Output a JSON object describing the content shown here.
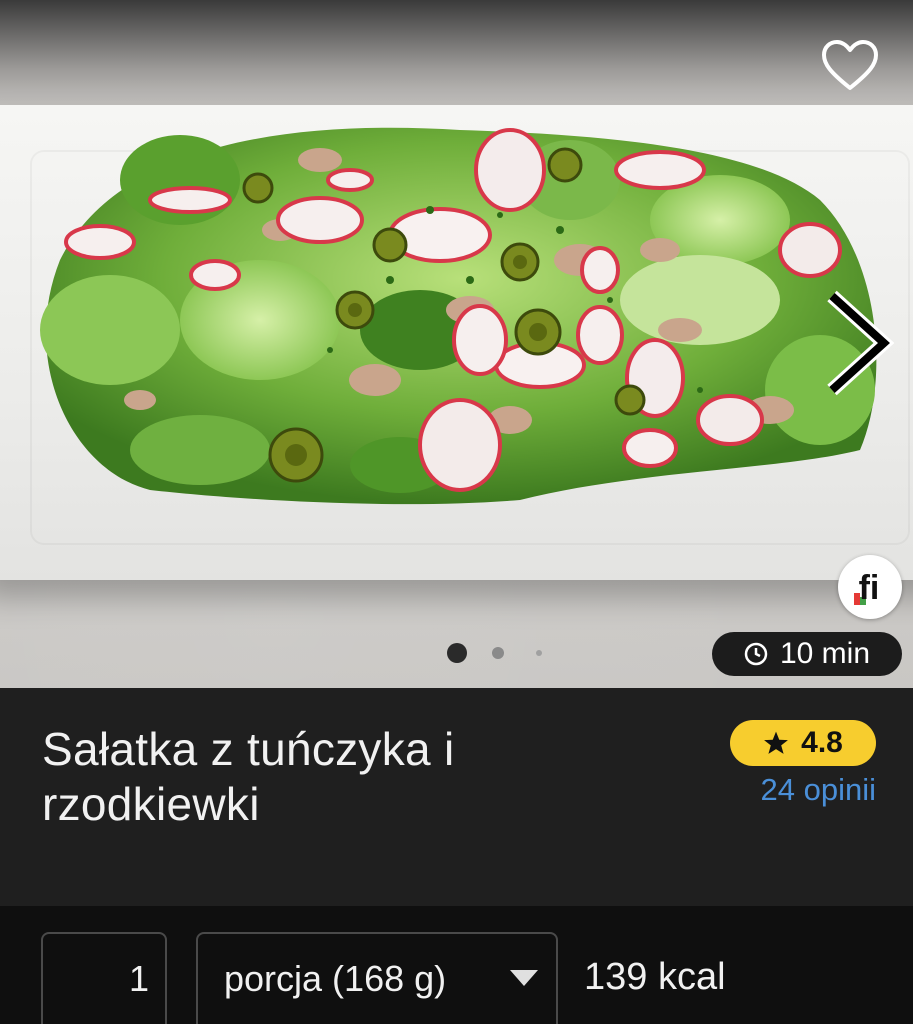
{
  "hero": {
    "favorite_icon": "heart-outline-icon",
    "next_icon": "chevron-right-icon",
    "brand_badge_text": "fi",
    "carousel_dots": 3,
    "carousel_active_index": 0,
    "time_icon": "clock-icon",
    "time_label": "10 min"
  },
  "recipe": {
    "title_line1": "Sałatka z tuńczyka i",
    "title_line2": "rzodkiewki",
    "rating_icon": "star-icon",
    "rating": "4.8",
    "reviews": "24 opinii"
  },
  "portion": {
    "quantity": "1",
    "unit": "porcja (168 g)",
    "unit_dropdown_icon": "triangle-down-icon",
    "calories": "139 kcal"
  },
  "colors": {
    "background": "#1f1f1f",
    "bottom_bar": "#0f0f0f",
    "rating_badge": "#f7cd2e",
    "reviews_link": "#4a8fd8",
    "text": "#f1f1f1"
  }
}
